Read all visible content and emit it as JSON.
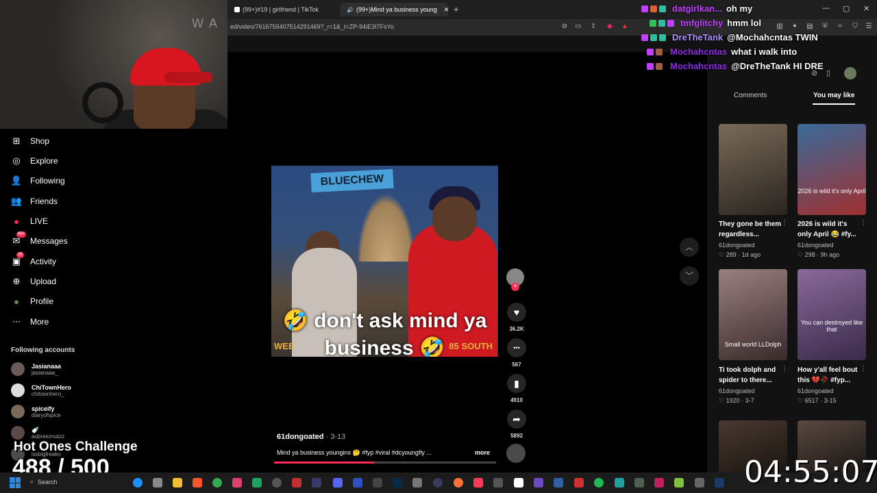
{
  "browser": {
    "tabs": [
      {
        "label": "(99+)#19 | girlfriend | TikTok"
      },
      {
        "label": "(99+)Mind ya business young"
      }
    ],
    "new_tab": "+",
    "url": "ed/video/7616759407514291469?_r=1&_t=ZP-94iE3I7FsYo"
  },
  "webcam": {
    "tag": "W A"
  },
  "chat": [
    {
      "name": "datgirlkan...",
      "msg": "oh my",
      "color": "#c040ff"
    },
    {
      "name": "tmfglitchy",
      "msg": "hmm lol",
      "color": "#c040ff"
    },
    {
      "name": "DreTheTank",
      "msg": "@Mochahcntas TWIN",
      "color": "#9a6cff"
    },
    {
      "name": "Mochahcntas",
      "msg": "what i walk into",
      "color": "#8a2be2"
    },
    {
      "name": "Mochahcntas",
      "msg": "@DreTheTank HI DRE",
      "color": "#8a2be2"
    }
  ],
  "nav": [
    {
      "label": "Shop",
      "icon": "shop-icon",
      "glyph": "⊞"
    },
    {
      "label": "Explore",
      "icon": "compass-icon",
      "glyph": "◎"
    },
    {
      "label": "Following",
      "icon": "following-icon",
      "glyph": "👤"
    },
    {
      "label": "Friends",
      "icon": "friends-icon",
      "glyph": "👥"
    },
    {
      "label": "LIVE",
      "icon": "live-icon",
      "glyph": "●"
    },
    {
      "label": "Messages",
      "icon": "messages-icon",
      "glyph": "✉",
      "badge": "99+"
    },
    {
      "label": "Activity",
      "icon": "activity-icon",
      "glyph": "▣",
      "badge": "29"
    },
    {
      "label": "Upload",
      "icon": "upload-icon",
      "glyph": "⊕"
    },
    {
      "label": "Profile",
      "icon": "profile-icon",
      "glyph": "●"
    },
    {
      "label": "More",
      "icon": "more-icon",
      "glyph": "⋯"
    }
  ],
  "following_header": "Following accounts",
  "following": [
    {
      "name": "Jasianaaa",
      "handle": "jasianaaa_"
    },
    {
      "name": "ChiTownHero",
      "handle": "chitownhero_"
    },
    {
      "name": "spiceify",
      "handle": "diaryofspice"
    },
    {
      "name": "🍼",
      "handle": "aubreeznutzz"
    },
    {
      "name": "",
      "handle": "issbigfreako"
    }
  ],
  "overlay": {
    "challenge": "Hot Ones Challenge",
    "counter": "488 / 500",
    "clock": "04:55:07"
  },
  "video": {
    "sign": "BLUECHEW",
    "caption_line1": "🤣 don't ask mind ya",
    "caption_line2": "business 🤣",
    "strip_left": "WEE",
    "strip_right": "85 SOUTH",
    "author": "61dongoated",
    "date": "· 3-13",
    "description": "Mind ya business youngins 🤔 #fyp #viral #dcyoungfly ...",
    "more": "more",
    "progress": 0.45
  },
  "actions": [
    {
      "name": "like",
      "icon": "heart-icon",
      "glyph": "♥",
      "count": "36.2K"
    },
    {
      "name": "comment",
      "icon": "comment-icon",
      "glyph": "•••",
      "count": "567"
    },
    {
      "name": "save",
      "icon": "bookmark-icon",
      "glyph": "▮",
      "count": "4910"
    },
    {
      "name": "share",
      "icon": "share-icon",
      "glyph": "➦",
      "count": "5892"
    }
  ],
  "right_panel": {
    "tabs": [
      "Comments",
      "You may like"
    ],
    "active_tab": "You may like",
    "cards": [
      {
        "title": "They gone be them regardless...",
        "author": "61dongoated",
        "likes": "289",
        "age": "1d ago",
        "thumb_text": "",
        "color1": "#5a4030",
        "color2": "#2a2520"
      },
      {
        "title": "2026 is wild it's only April 😂 #fy...",
        "author": "61dongoated",
        "likes": "298",
        "age": "9h ago",
        "thumb_text": "2026 is wild it's only April",
        "color1": "#3a6a9a",
        "color2": "#a03030"
      },
      {
        "title": "Ti took dolph and spider to there...",
        "author": "61dongoated",
        "likes": "1920",
        "age": "3-7",
        "thumb_text": "Small world LLDolph",
        "color1": "#7a6060",
        "color2": "#3a2a2a"
      },
      {
        "title": "How y'all feel bout this 💔🥀 #fyp...",
        "author": "61dongoated",
        "likes": "6517",
        "age": "3-15",
        "thumb_text": "You can destroyed like that",
        "color1": "#6a4a7a",
        "color2": "#3a2a4a"
      }
    ]
  },
  "taskbar": {
    "search": "Search"
  }
}
